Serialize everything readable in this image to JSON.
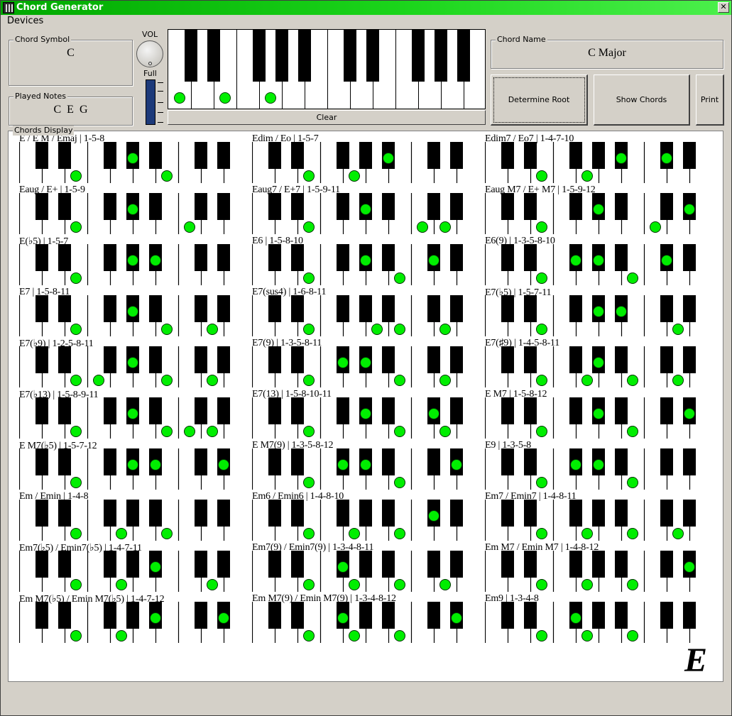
{
  "window": {
    "title": "Chord Generator",
    "close_glyph": "✕"
  },
  "menu": {
    "devices": "Devices"
  },
  "chord_symbol": {
    "legend": "Chord Symbol",
    "value": "C"
  },
  "volume": {
    "label": "VOL",
    "level_label": "Full",
    "level": 1.0
  },
  "played_notes": {
    "legend": "Played Notes",
    "value": "C  E  G"
  },
  "keyboard": {
    "white_keys": 14,
    "black_key_after_white": [
      0,
      1,
      3,
      4,
      5,
      7,
      8,
      10,
      11,
      12
    ],
    "pressed_white_keys": [
      0,
      2,
      4
    ],
    "clear_label": "Clear"
  },
  "chord_name": {
    "legend": "Chord Name",
    "value": "C Major"
  },
  "buttons": {
    "determine_root": "Determine Root",
    "show_chords": "Show Chords",
    "print": "Print"
  },
  "chords_display": {
    "legend": "Chords Display",
    "big_letter": "E",
    "chords": [
      {
        "label": "E / E M / Emaj  |  1-5-8",
        "notes": [
          4,
          8,
          11
        ]
      },
      {
        "label": "Edim / Eo  |  1-5-7",
        "notes": [
          4,
          7,
          10
        ]
      },
      {
        "label": "Edim7 / Eo7  |  1-4-7-10",
        "notes": [
          4,
          7,
          10,
          13
        ]
      },
      {
        "label": "Eaug / E+  |  1-5-9",
        "notes": [
          4,
          8,
          12
        ]
      },
      {
        "label": "Eaug7 / E+7  |  1-5-9-11",
        "notes": [
          4,
          8,
          12,
          14
        ]
      },
      {
        "label": "Eaug M7 / E+ M7  |  1-5-9-12",
        "notes": [
          4,
          8,
          12,
          15
        ]
      },
      {
        "label": "E(♭5)  |  1-5-7",
        "notes": [
          4,
          8,
          10
        ]
      },
      {
        "label": "E6  |  1-5-8-10",
        "notes": [
          4,
          8,
          11,
          13
        ]
      },
      {
        "label": "E6(9)  |  1-3-5-8-10",
        "notes": [
          4,
          6,
          8,
          11,
          13
        ]
      },
      {
        "label": "E7  |  1-5-8-11",
        "notes": [
          4,
          8,
          11,
          14
        ]
      },
      {
        "label": "E7(sus4)  |  1-6-8-11",
        "notes": [
          4,
          9,
          11,
          14
        ]
      },
      {
        "label": "E7(♭5)  |  1-5-7-11",
        "notes": [
          4,
          8,
          10,
          14
        ]
      },
      {
        "label": "E7(♭9)  |  1-2-5-8-11",
        "notes": [
          4,
          5,
          8,
          11,
          14
        ]
      },
      {
        "label": "E7(9)  |  1-3-5-8-11",
        "notes": [
          4,
          6,
          8,
          11,
          14
        ]
      },
      {
        "label": "E7(♯9)  |  1-4-5-8-11",
        "notes": [
          4,
          7,
          8,
          11,
          14
        ]
      },
      {
        "label": "E7(♭13)  |  1-5-8-9-11",
        "notes": [
          4,
          8,
          11,
          12,
          14
        ]
      },
      {
        "label": "E7(13)  |  1-5-8-10-11",
        "notes": [
          4,
          8,
          11,
          13,
          14
        ]
      },
      {
        "label": "E M7  |  1-5-8-12",
        "notes": [
          4,
          8,
          11,
          15
        ]
      },
      {
        "label": "E M7(♭5)  |  1-5-7-12",
        "notes": [
          4,
          8,
          10,
          15
        ]
      },
      {
        "label": "E M7(9)  |  1-3-5-8-12",
        "notes": [
          4,
          6,
          8,
          11,
          15
        ]
      },
      {
        "label": "E9  |  1-3-5-8",
        "notes": [
          4,
          6,
          8,
          11
        ]
      },
      {
        "label": "Em / Emin  |  1-4-8",
        "notes": [
          4,
          7,
          11
        ]
      },
      {
        "label": "Em6 / Emin6  |  1-4-8-10",
        "notes": [
          4,
          7,
          11,
          13
        ]
      },
      {
        "label": "Em7 / Emin7  |  1-4-8-11",
        "notes": [
          4,
          7,
          11,
          14
        ]
      },
      {
        "label": "Em7(♭5) / Emin7(♭5)  |  1-4-7-11",
        "notes": [
          4,
          7,
          10,
          14
        ]
      },
      {
        "label": "Em7(9) / Emin7(9)  |  1-3-4-8-11",
        "notes": [
          4,
          6,
          7,
          11,
          14
        ]
      },
      {
        "label": "Em M7 / Emin M7  |  1-4-8-12",
        "notes": [
          4,
          7,
          11,
          15
        ]
      },
      {
        "label": "Em M7(♭5) / Emin M7(♭5)  |  1-4-7-12",
        "notes": [
          4,
          7,
          10,
          15
        ]
      },
      {
        "label": "Em M7(9) / Emin M7(9)  |  1-3-4-8-12",
        "notes": [
          4,
          6,
          7,
          11,
          15
        ]
      },
      {
        "label": "Em9  |  1-3-4-8",
        "notes": [
          4,
          6,
          7,
          11
        ]
      }
    ]
  }
}
